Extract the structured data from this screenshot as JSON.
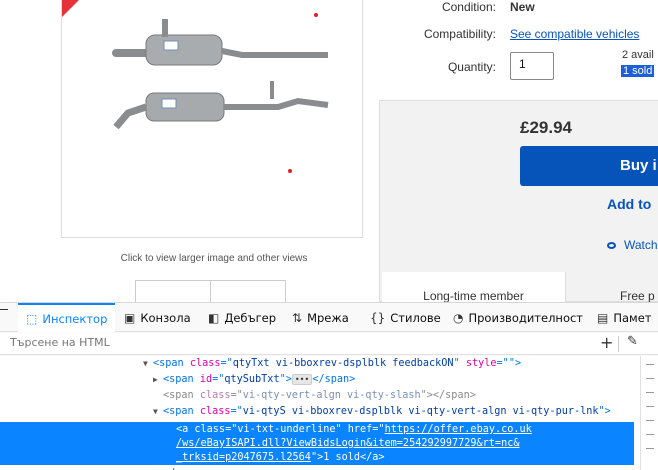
{
  "listing": {
    "condition_label": "Condition:",
    "condition_value": "New",
    "compatibility_label": "Compatibility:",
    "compatibility_link": "See compatible vehicles",
    "quantity_label": "Quantity:",
    "quantity_value": "1",
    "available_text": "2 avail",
    "sold_text": "1 sold",
    "image_caption": "Click to view larger image and other views",
    "price": "£29.94",
    "buy_label": "Buy i",
    "add_label": "Add to",
    "watch_label": "Watch",
    "long_time_member": "Long-time member",
    "free_label": "Free p"
  },
  "devtools": {
    "tabs": [
      {
        "label": "Инспектор",
        "icon": "inspector-icon"
      },
      {
        "label": "Конзола",
        "icon": "console-icon"
      },
      {
        "label": "Дебъгер",
        "icon": "debugger-icon"
      },
      {
        "label": "Мрежа",
        "icon": "network-icon"
      },
      {
        "label": "Стилове",
        "icon": "style-editor-icon"
      },
      {
        "label": "Производителност",
        "icon": "performance-icon"
      },
      {
        "label": "Памет",
        "icon": "memory-icon"
      }
    ],
    "search_placeholder": "Търсене на HTML",
    "tree": {
      "r1_class": "qtyTxt vi-bboxrev-dsplblk feedbackON",
      "r1_style": "",
      "r2_id": "qtySubTxt",
      "r3_class": "vi-qty-vert-algn vi-qty-slash",
      "r4_class": "vi-qtyS vi-bboxrev-dsplblk vi-qty-vert-algn vi-qty-pur-lnk",
      "sel_class": "vi-txt-underline",
      "sel_href_1": "https://offer.ebay.co.uk",
      "sel_href_2": "/ws/eBayISAPI.dll?ViewBidsLogin&item=254292997729&rt=nc&",
      "sel_href_3": "_trksid=p2047675.l2564",
      "sel_text": "1 sold"
    }
  },
  "colors": {
    "ebay_blue": "#0654ba",
    "devtools_accent": "#0a84ff",
    "selection_bg": "#0a84ff"
  }
}
